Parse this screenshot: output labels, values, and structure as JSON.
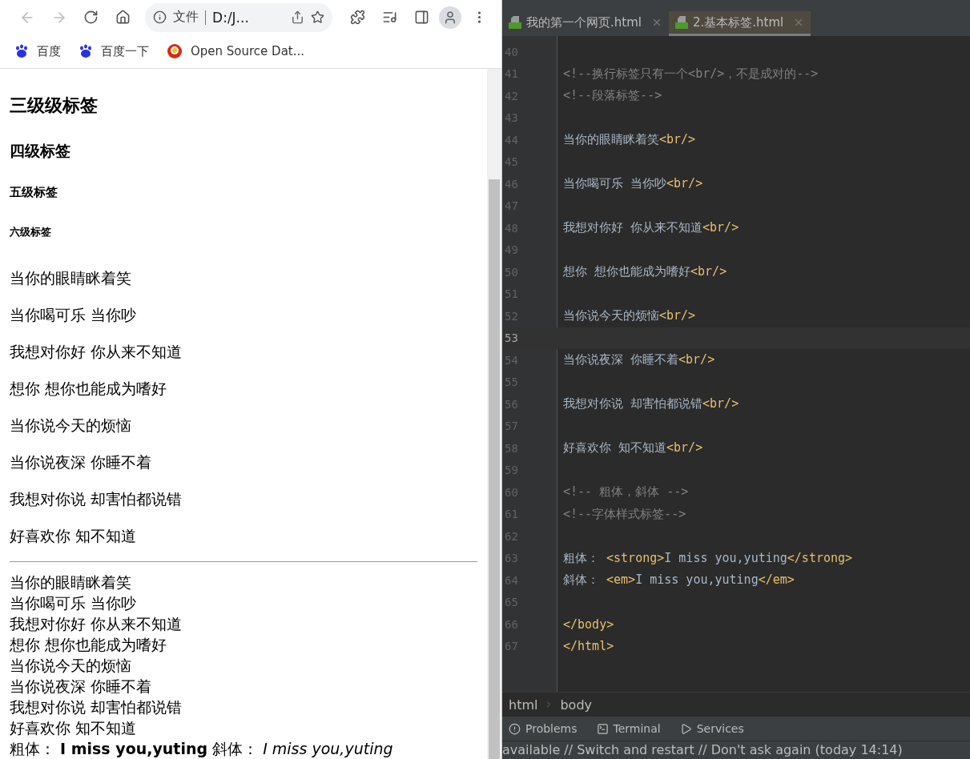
{
  "browser": {
    "nav": {
      "back_disabled": true,
      "forward_disabled": true
    },
    "address": {
      "scheme_label": "文件",
      "url": "D:/J..."
    },
    "bookmarks": [
      {
        "label": "百度",
        "kind": "paw"
      },
      {
        "label": "百度一下",
        "kind": "paw"
      },
      {
        "label": "Open Source Dat...",
        "kind": "ring"
      }
    ],
    "page": {
      "headings": [
        {
          "kind": "h3",
          "text": "三级级标签"
        },
        {
          "kind": "h4",
          "text": "四级标签"
        },
        {
          "kind": "h5",
          "text": "五级标签"
        },
        {
          "kind": "h6",
          "text": "六级标签"
        }
      ],
      "paragraphs": [
        "当你的眼睛眯着笑",
        "当你喝可乐 当你吵",
        "我想对你好 你从来不知道",
        "想你 想你也能成为嗜好",
        "当你说今天的烦恼",
        "当你说夜深 你睡不着",
        "我想对你说 却害怕都说错",
        "好喜欢你 知不知道"
      ],
      "lines": [
        "当你的眼睛眯着笑",
        "当你喝可乐 当你吵",
        "我想对你好 你从来不知道",
        "想你 想你也能成为嗜好",
        "当你说今天的烦恼",
        "当你说夜深 你睡不着",
        "我想对你说 却害怕都说错",
        "好喜欢你 知不知道"
      ],
      "last_line": "粗体： **I miss you,yuting** 斜体： *I miss you,yuting*"
    }
  },
  "editor": {
    "tabs": [
      {
        "label": "我的第一个网页.html",
        "selected": false
      },
      {
        "label": "2.基本标签.html",
        "selected": true
      }
    ],
    "lines": [
      {
        "num": "40",
        "current": false
      },
      {
        "num": "41",
        "current": false,
        "segments": [
          {
            "kind": "comment",
            "text": "<!--换行标签只有一个<br/>，不是成对的-->"
          }
        ]
      },
      {
        "num": "42",
        "current": false,
        "segments": [
          {
            "kind": "comment",
            "text": "<!--段落标签-->"
          }
        ]
      },
      {
        "num": "43",
        "current": false
      },
      {
        "num": "44",
        "current": false,
        "segments": [
          {
            "kind": "text",
            "text": "当你的眼睛眯着笑"
          },
          {
            "kind": "tag",
            "text": "<br/>"
          }
        ]
      },
      {
        "num": "45",
        "current": false
      },
      {
        "num": "46",
        "current": false,
        "segments": [
          {
            "kind": "text",
            "text": "当你喝可乐 当你吵"
          },
          {
            "kind": "tag",
            "text": "<br/>"
          }
        ]
      },
      {
        "num": "47",
        "current": false
      },
      {
        "num": "48",
        "current": false,
        "segments": [
          {
            "kind": "text",
            "text": "我想对你好 你从来不知道"
          },
          {
            "kind": "tag",
            "text": "<br/>"
          }
        ]
      },
      {
        "num": "49",
        "current": false
      },
      {
        "num": "50",
        "current": false,
        "segments": [
          {
            "kind": "text",
            "text": "想你 想你也能成为嗜好"
          },
          {
            "kind": "tag",
            "text": "<br/>"
          }
        ]
      },
      {
        "num": "51",
        "current": false
      },
      {
        "num": "52",
        "current": false,
        "segments": [
          {
            "kind": "text",
            "text": "当你说今天的烦恼"
          },
          {
            "kind": "tag",
            "text": "<br/>"
          }
        ]
      },
      {
        "num": "53",
        "current": true
      },
      {
        "num": "54",
        "current": false,
        "segments": [
          {
            "kind": "text",
            "text": "当你说夜深 你睡不着"
          },
          {
            "kind": "tag",
            "text": "<br/>"
          }
        ]
      },
      {
        "num": "55",
        "current": false
      },
      {
        "num": "56",
        "current": false,
        "segments": [
          {
            "kind": "text",
            "text": "我想对你说 却害怕都说错"
          },
          {
            "kind": "tag",
            "text": "<br/>"
          }
        ]
      },
      {
        "num": "57",
        "current": false
      },
      {
        "num": "58",
        "current": false,
        "segments": [
          {
            "kind": "text",
            "text": "好喜欢你 知不知道"
          },
          {
            "kind": "tag",
            "text": "<br/>"
          }
        ]
      },
      {
        "num": "59",
        "current": false
      },
      {
        "num": "60",
        "current": false,
        "segments": [
          {
            "kind": "comment",
            "text": "<!-- 粗体，斜体 -->"
          }
        ]
      },
      {
        "num": "61",
        "current": false,
        "segments": [
          {
            "kind": "comment",
            "text": "<!--字体样式标签-->"
          }
        ]
      },
      {
        "num": "62",
        "current": false
      },
      {
        "num": "63",
        "current": false,
        "segments": [
          {
            "kind": "text",
            "text": "粗体： "
          },
          {
            "kind": "tag",
            "text": "<strong>"
          },
          {
            "kind": "text",
            "text": "I miss you,yuting"
          },
          {
            "kind": "tag",
            "text": "</strong>"
          }
        ]
      },
      {
        "num": "64",
        "current": false,
        "segments": [
          {
            "kind": "text",
            "text": "斜体： "
          },
          {
            "kind": "tag",
            "text": "<em>"
          },
          {
            "kind": "text",
            "text": "I miss you,yuting"
          },
          {
            "kind": "tag",
            "text": "</em>"
          }
        ]
      },
      {
        "num": "65",
        "current": false
      },
      {
        "num": "66",
        "current": false,
        "segments": [
          {
            "kind": "tag",
            "text": "</body>"
          }
        ]
      },
      {
        "num": "67",
        "current": false,
        "segments": [
          {
            "kind": "tag",
            "text": "</html>"
          }
        ]
      }
    ],
    "breadcrumbs": [
      "html",
      "body"
    ],
    "tool_windows": [
      {
        "label": "Problems",
        "kind": "problems"
      },
      {
        "label": "Terminal",
        "kind": "terminal"
      },
      {
        "label": "Services",
        "kind": "services"
      }
    ],
    "status": "available // Switch and restart // Don't ask again (today 14:14)"
  }
}
